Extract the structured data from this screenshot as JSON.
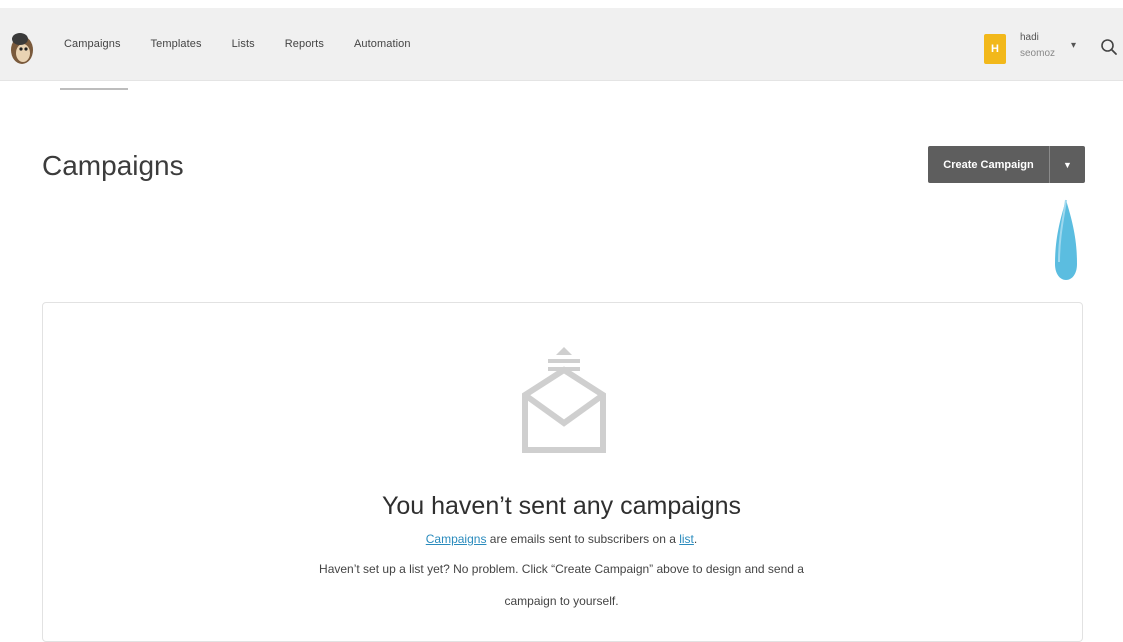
{
  "nav": {
    "items": [
      {
        "label": "Campaigns",
        "active": true
      },
      {
        "label": "Templates",
        "active": false
      },
      {
        "label": "Lists",
        "active": false
      },
      {
        "label": "Reports",
        "active": false
      },
      {
        "label": "Automation",
        "active": false
      }
    ]
  },
  "user": {
    "avatar_letter": "H",
    "name": "hadi",
    "org": "seomoz"
  },
  "page": {
    "title": "Campaigns"
  },
  "actions": {
    "create_label": "Create Campaign"
  },
  "empty_state": {
    "title": "You haven’t sent any campaigns",
    "line1_link1": "Campaigns",
    "line1_middle": " are emails sent to subscribers on a ",
    "line1_link2": "list",
    "line1_end": ".",
    "line2": "Haven’t set up a list yet? No problem. Click “Create Campaign” above to design and send a",
    "line3": "campaign to yourself."
  },
  "colors": {
    "topbar": "#f0f0f0",
    "button": "#5e5e5e",
    "avatar": "#f2b81a",
    "link": "#2a8bbd",
    "pointer": "#5bbde0"
  },
  "icons": {
    "logo": "freddie-monkey-logo-icon",
    "search": "search-icon",
    "caret": "chevron-down-icon",
    "empty": "envelope-icon"
  }
}
